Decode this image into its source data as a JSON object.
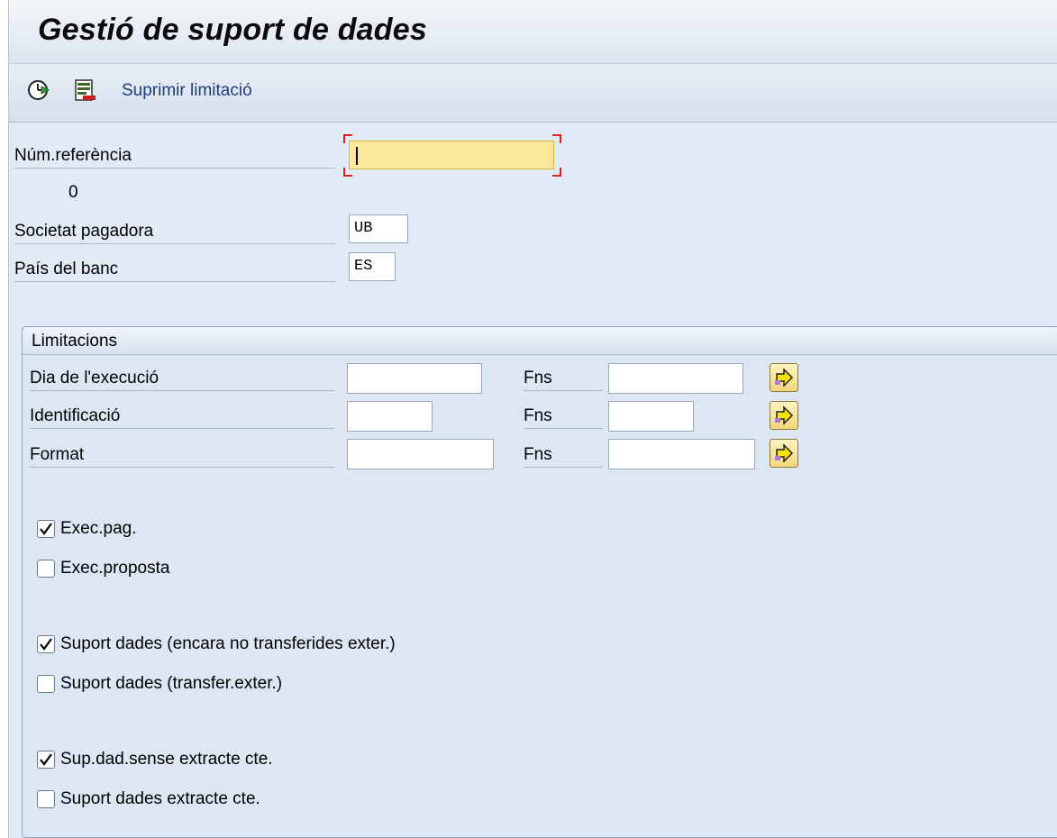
{
  "app": {
    "title": "Gestió de suport de dades"
  },
  "toolbar": {
    "execute_icon": "clock-execute-icon",
    "variant_icon": "save-variant-icon",
    "link_label": "Suprimir limitació"
  },
  "header_fields": {
    "reference": {
      "label": "Núm.referència",
      "value": "",
      "value_below": "0"
    },
    "company": {
      "label": "Societat pagadora",
      "value": "UB"
    },
    "country": {
      "label": "País del banc",
      "value": "ES"
    }
  },
  "limits": {
    "title": "Limitacions",
    "rows": [
      {
        "label": "Dia de l'execució",
        "to_label": "Fns",
        "from": "",
        "to": ""
      },
      {
        "label": "Identificació",
        "to_label": "Fns",
        "from": "",
        "to": ""
      },
      {
        "label": "Format",
        "to_label": "Fns",
        "from": "",
        "to": ""
      }
    ],
    "checkboxes": [
      {
        "label": "Exec.pag.",
        "checked": true
      },
      {
        "label": "Exec.proposta",
        "checked": false
      },
      {
        "label": "Suport dades (encara no transferides exter.)",
        "checked": true
      },
      {
        "label": "Suport dades (transfer.exter.)",
        "checked": false
      },
      {
        "label": "Sup.dad.sense extracte cte.",
        "checked": true
      },
      {
        "label": "Suport dades extracte cte.",
        "checked": false
      }
    ]
  },
  "colors": {
    "required_field": "#fbe89b",
    "background": "#e1eaf5",
    "multiple_selection_button": "#f2d77a"
  }
}
